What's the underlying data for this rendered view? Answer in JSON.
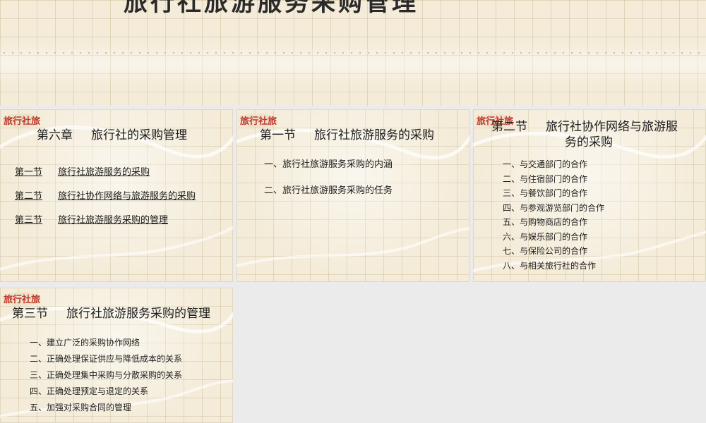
{
  "banner": {
    "title": "旅行社旅游服务采购管理"
  },
  "slides": [
    {
      "logo_text": "旅行社旅",
      "title_part1": "第六章",
      "title_part2": "旅行社的采购管理",
      "links": [
        {
          "num": "第一节",
          "text": "旅行社旅游服务的采购"
        },
        {
          "num": "第二节",
          "text": "旅行社协作网络与旅游服务的采购"
        },
        {
          "num": "第三节",
          "text": "旅行社旅游服务采购的管理"
        }
      ]
    },
    {
      "logo_text": "旅行社旅",
      "title_part1": "第一节",
      "title_part2": "旅行社旅游服务的采购",
      "items": [
        "一、旅行社旅游服务采购的内涵",
        "二、旅行社旅游服务采购的任务"
      ]
    },
    {
      "logo_text": "旅行社旅",
      "title_line1_part1": "第二节",
      "title_line1_part2": "旅行社协作网络与旅游服",
      "title_line2": "务的采购",
      "items": [
        "一、与交通部门的合作",
        "二、与住宿部门的合作",
        "三、与餐饮部门的合作",
        "四、与参观游览部门的合作",
        "五、与购物商店的合作",
        "六、与娱乐部门的合作",
        "七、与保险公司的合作",
        "八、与相关旅行社的合作"
      ]
    },
    {
      "logo_text": "旅行社旅",
      "title_part1": "第三节",
      "title_part2": "旅行社旅游服务采购的管理",
      "items": [
        "一、建立广泛的采购协作网络",
        "二、正确处理保证供应与降低成本的关系",
        "三、正确处理集中采购与分散采购的关系",
        "四、正确处理预定与退定的关系",
        "五、加强对采购合同的管理"
      ]
    }
  ],
  "colors": {
    "slide_bg": "#f4ecd9",
    "workspace_bg": "#ebebeb",
    "logo_red": "#c0392b"
  }
}
